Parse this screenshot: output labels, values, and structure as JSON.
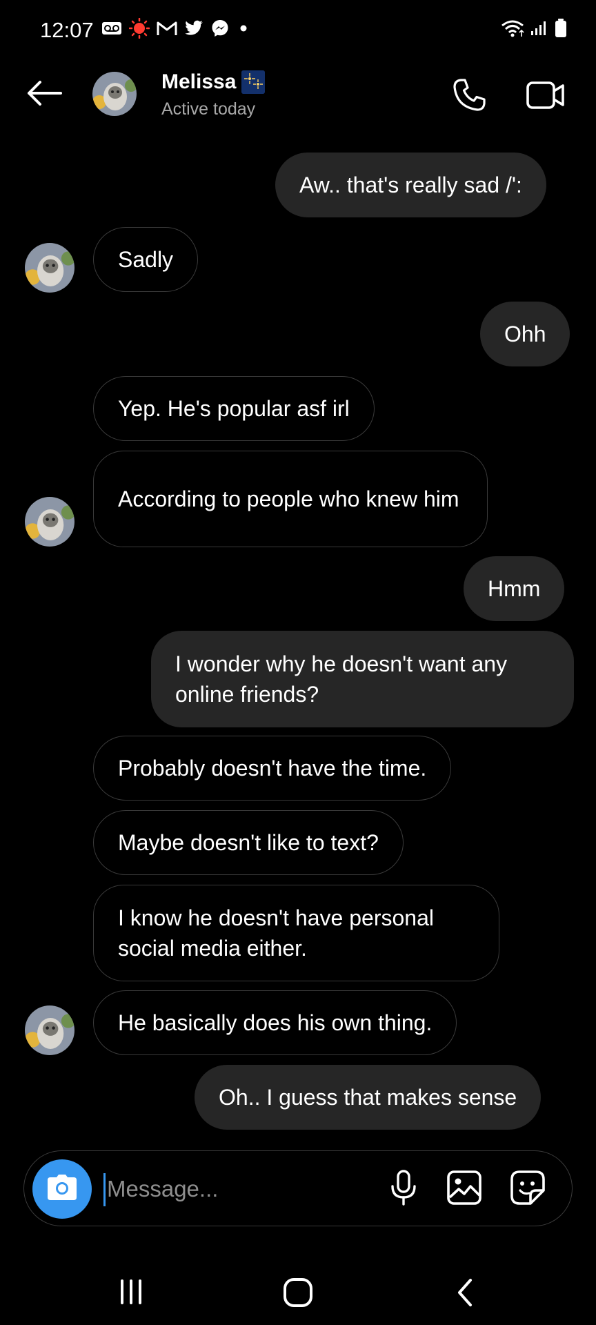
{
  "status_bar": {
    "time": "12:07",
    "icons": [
      "voicemail-icon",
      "record-icon",
      "gmail-icon",
      "twitter-icon",
      "messenger-icon",
      "dot-icon",
      "wifi-icon",
      "signal-icon",
      "battery-icon"
    ]
  },
  "header": {
    "name": "Melissa",
    "status": "Active today",
    "icons": [
      "back-arrow-icon",
      "phone-icon",
      "video-camera-icon"
    ]
  },
  "messages": [
    {
      "side": "out",
      "text": "Aw.. that's really sad /':"
    },
    {
      "side": "in",
      "text": "Sadly",
      "avatar": true
    },
    {
      "side": "out",
      "text": "Ohh"
    },
    {
      "side": "in",
      "text": "Yep. He's popular asf irl"
    },
    {
      "side": "in",
      "text": "According to people who knew him",
      "avatar": true
    },
    {
      "side": "out",
      "text": "Hmm"
    },
    {
      "side": "out",
      "text": "I wonder why he doesn't want any online friends?"
    },
    {
      "side": "in",
      "text": "Probably doesn't have the time."
    },
    {
      "side": "in",
      "text": "Maybe doesn't like to text?"
    },
    {
      "side": "in",
      "text": "I know he doesn't have personal social media either."
    },
    {
      "side": "in",
      "text": "He basically does his own thing.",
      "avatar": true
    },
    {
      "side": "out",
      "text": "Oh.. I guess that makes sense"
    }
  ],
  "composer": {
    "placeholder": "Message...",
    "value": "",
    "icons": [
      "camera-icon",
      "microphone-icon",
      "gallery-icon",
      "sticker-icon"
    ]
  },
  "nav_bar": {
    "icons": [
      "recents-icon",
      "home-icon",
      "back-icon"
    ]
  },
  "colors": {
    "background": "#000000",
    "outgoing_bubble": "#262626",
    "incoming_border": "#3a3a3a",
    "accent": "#3797f0",
    "muted_text": "#a8a8a8"
  }
}
